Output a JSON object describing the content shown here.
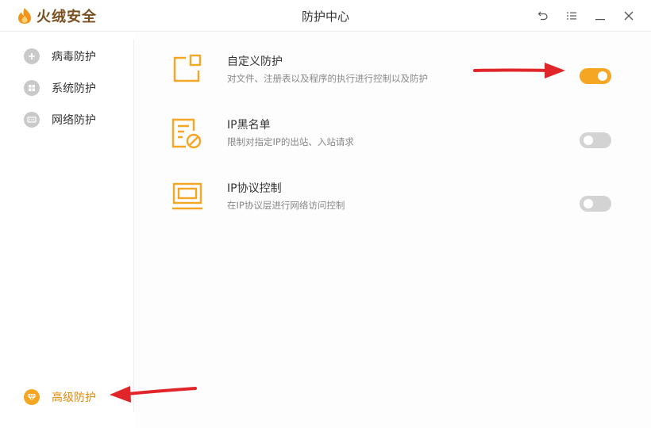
{
  "app": {
    "name": "火绒安全",
    "window_title": "防护中心"
  },
  "sidebar": {
    "items": [
      {
        "label": "病毒防护"
      },
      {
        "label": "系统防护"
      },
      {
        "label": "网络防护"
      }
    ],
    "bottom_item": {
      "label": "高级防护",
      "active": true
    }
  },
  "rules": [
    {
      "title": "自定义防护",
      "desc": "对文件、注册表以及程序的执行进行控制以及防护",
      "enabled": true
    },
    {
      "title": "IP黑名单",
      "desc": "限制对指定IP的出站、入站请求",
      "enabled": false
    },
    {
      "title": "IP协议控制",
      "desc": "在IP协议层进行网络访问控制",
      "enabled": false
    }
  ],
  "colors": {
    "accent": "#f5a623",
    "arrow": "#e0262b"
  }
}
